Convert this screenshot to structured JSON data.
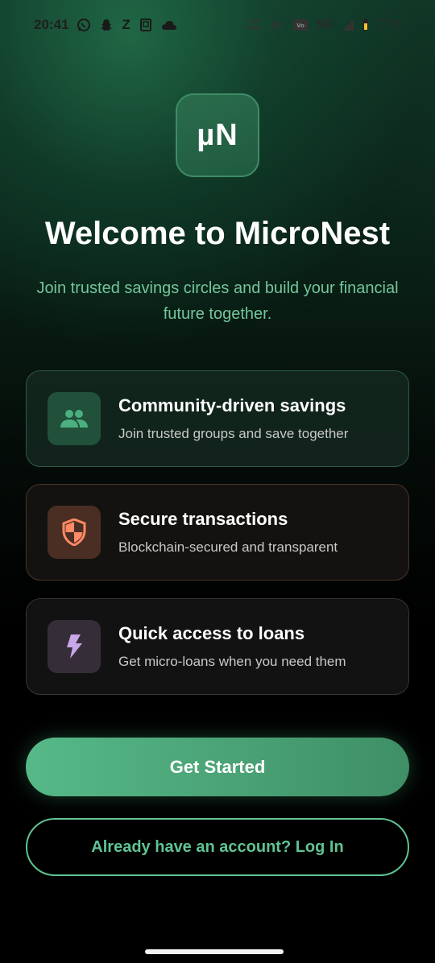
{
  "status_bar": {
    "time": "20:41",
    "left_icons": [
      "whatsapp-icon",
      "snapchat-icon",
      "z-icon",
      "screen-icon",
      "cloud-icon"
    ],
    "network_speed": "1.05\nKB/s",
    "network_type": "5G",
    "battery": "77%"
  },
  "logo": {
    "text": "µN"
  },
  "title": "Welcome to MicroNest",
  "subtitle": "Join trusted savings circles and build your financial future together.",
  "features": [
    {
      "icon": "people-icon",
      "title": "Community-driven savings",
      "description": "Join trusted groups and save together",
      "accent": "#4caf80"
    },
    {
      "icon": "shield-icon",
      "title": "Secure transactions",
      "description": "Blockchain-secured and transparent",
      "accent": "#ff8a65"
    },
    {
      "icon": "lightning-icon",
      "title": "Quick access to loans",
      "description": "Get micro-loans when you need them",
      "accent": "#c9a7e8"
    }
  ],
  "actions": {
    "get_started": "Get Started",
    "login": "Already have an account? Log In"
  },
  "colors": {
    "brand_green": "#56b987",
    "subtitle_green": "#74c59b"
  }
}
